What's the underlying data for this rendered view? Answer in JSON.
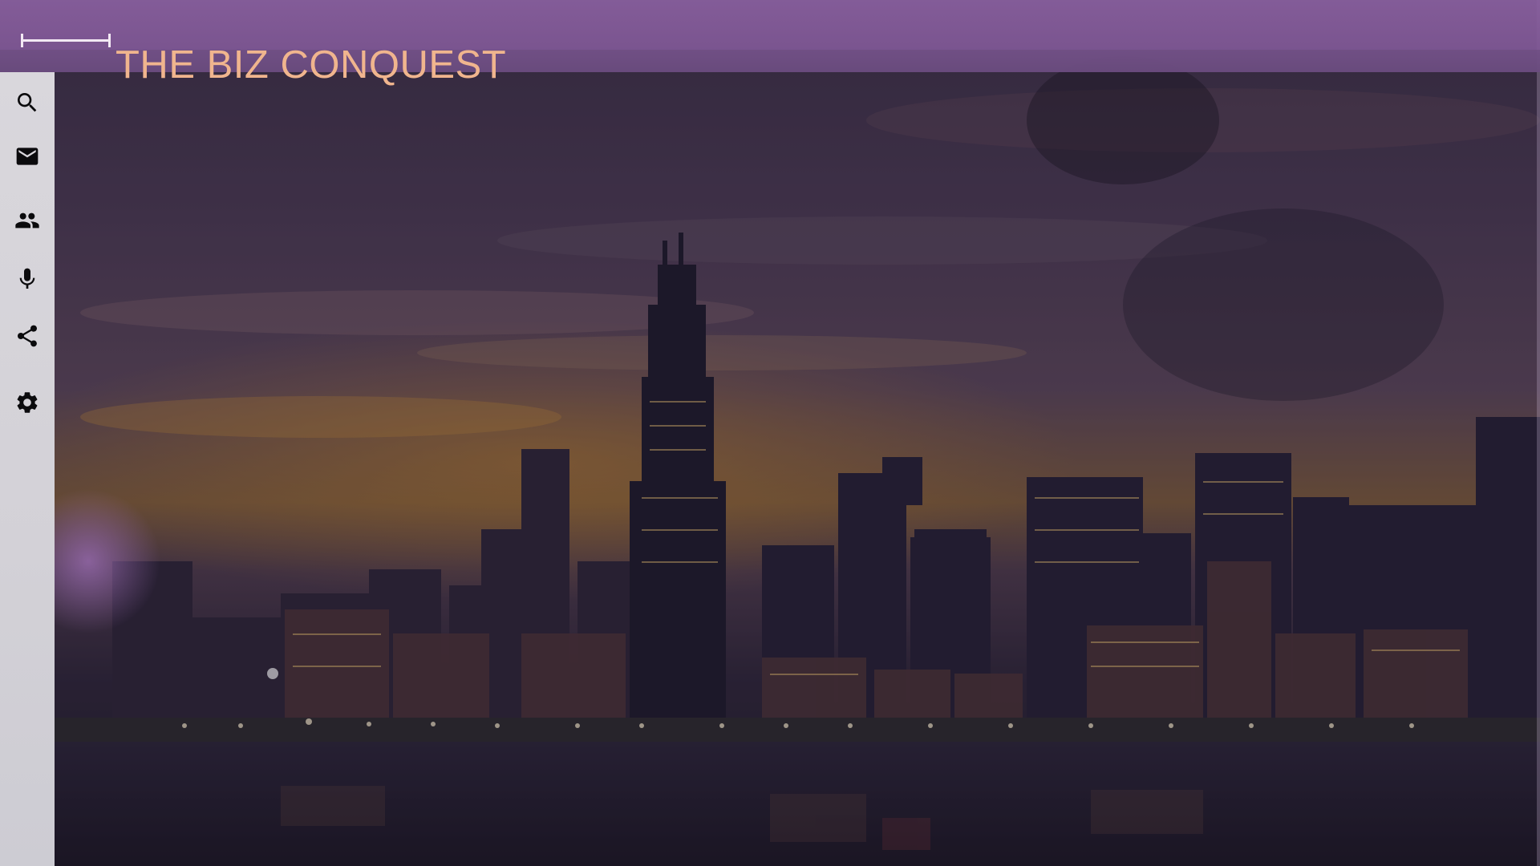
{
  "site": {
    "title": "THE BIZ CONQUEST"
  },
  "header": {
    "menu_icon": "horizontal-slider-icon"
  },
  "sidebar": {
    "items": [
      {
        "name": "search",
        "icon": "search-icon",
        "label": ""
      },
      {
        "name": "mail",
        "icon": "mail-icon",
        "label": ""
      },
      {
        "name": "people",
        "icon": "people-icon",
        "label": ""
      },
      {
        "name": "microphone",
        "icon": "microphone-icon",
        "label": ""
      },
      {
        "name": "share",
        "icon": "share-icon",
        "label": ""
      },
      {
        "name": "settings",
        "icon": "gear-icon",
        "label": ""
      }
    ]
  },
  "colors": {
    "header_bg": "#8a60a0",
    "title": "#f0b58e",
    "sidebar_bg": "#d6d4da",
    "icon": "#0b0b0d"
  },
  "background": {
    "description_icon": "city-skyline-image"
  }
}
